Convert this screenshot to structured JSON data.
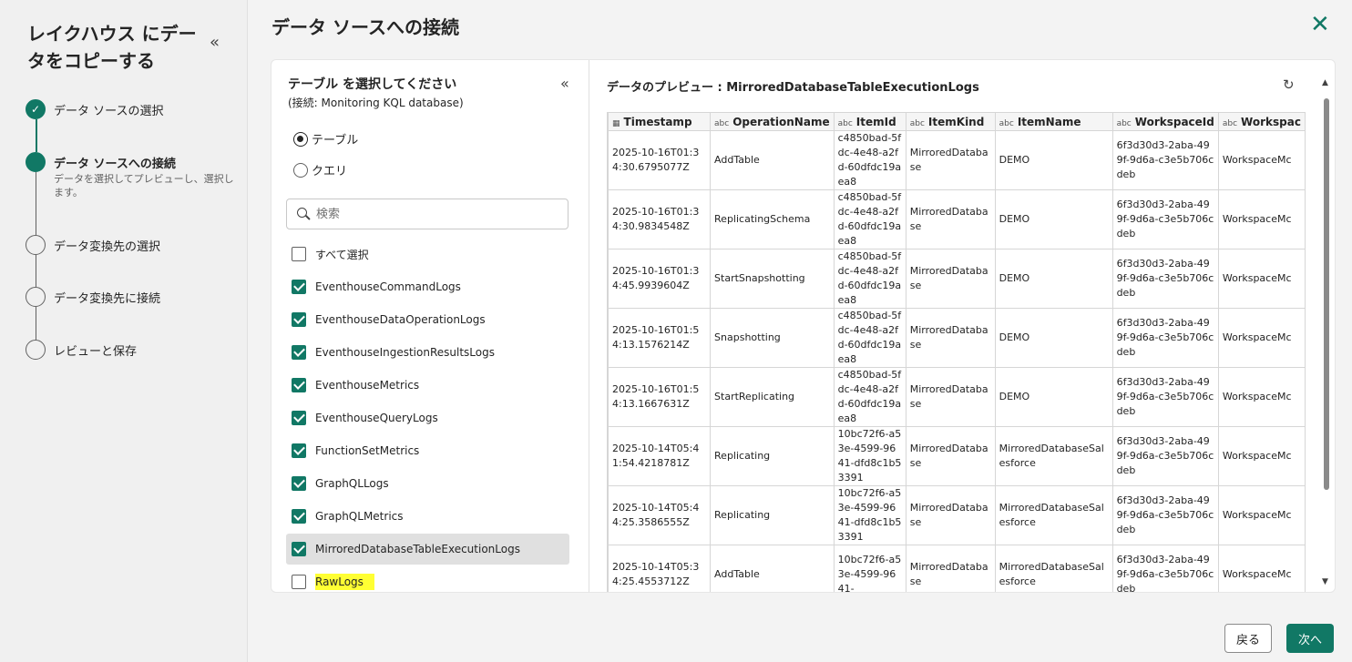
{
  "wizard": {
    "title": "レイクハウス にデータをコピーする",
    "steps": [
      {
        "label": "データ ソースの選択",
        "state": "done"
      },
      {
        "label": "データ ソースへの接続",
        "state": "active",
        "desc": "データを選択してプレビューし、選択します。"
      },
      {
        "label": "データ変換先の選択",
        "state": "pending"
      },
      {
        "label": "データ変換先に接続",
        "state": "pending"
      },
      {
        "label": "レビューと保存",
        "state": "pending"
      }
    ]
  },
  "main": {
    "title": "データ ソースへの接続"
  },
  "selector": {
    "title": "テーブル を選択してください",
    "subtitle": "(接続: Monitoring KQL database)",
    "radio_table": "テーブル",
    "radio_query": "クエリ",
    "search_placeholder": "検索",
    "select_all": "すべて選択",
    "tables": [
      {
        "name": "EventhouseCommandLogs",
        "checked": true
      },
      {
        "name": "EventhouseDataOperationLogs",
        "checked": true
      },
      {
        "name": "EventhouseIngestionResultsLogs",
        "checked": true
      },
      {
        "name": "EventhouseMetrics",
        "checked": true
      },
      {
        "name": "EventhouseQueryLogs",
        "checked": true
      },
      {
        "name": "FunctionSetMetrics",
        "checked": true
      },
      {
        "name": "GraphQLLogs",
        "checked": true
      },
      {
        "name": "GraphQLMetrics",
        "checked": true
      },
      {
        "name": "MirroredDatabaseTableExecutionLogs",
        "checked": true
      },
      {
        "name": "RawLogs",
        "checked": false
      }
    ]
  },
  "preview": {
    "title": "データのプレビュー : MirroredDatabaseTableExecutionLogs",
    "columns": [
      {
        "name": "Timestamp",
        "type": "date"
      },
      {
        "name": "OperationName",
        "type": "abc"
      },
      {
        "name": "ItemId",
        "type": "abc"
      },
      {
        "name": "ItemKind",
        "type": "abc"
      },
      {
        "name": "ItemName",
        "type": "abc"
      },
      {
        "name": "WorkspaceId",
        "type": "abc"
      },
      {
        "name": "Workspac",
        "type": "abc"
      }
    ],
    "rows": [
      [
        "2025-10-16T01:34:30.6795077Z",
        "AddTable",
        "c4850bad-5fdc-4e48-a2fd-60dfdc19aea8",
        "MirroredDatabase",
        "DEMO",
        "6f3d30d3-2aba-499f-9d6a-c3e5b706cdeb",
        "WorkspaceMc"
      ],
      [
        "2025-10-16T01:34:30.9834548Z",
        "ReplicatingSchema",
        "c4850bad-5fdc-4e48-a2fd-60dfdc19aea8",
        "MirroredDatabase",
        "DEMO",
        "6f3d30d3-2aba-499f-9d6a-c3e5b706cdeb",
        "WorkspaceMc"
      ],
      [
        "2025-10-16T01:34:45.9939604Z",
        "StartSnapshotting",
        "c4850bad-5fdc-4e48-a2fd-60dfdc19aea8",
        "MirroredDatabase",
        "DEMO",
        "6f3d30d3-2aba-499f-9d6a-c3e5b706cdeb",
        "WorkspaceMc"
      ],
      [
        "2025-10-16T01:54:13.1576214Z",
        "Snapshotting",
        "c4850bad-5fdc-4e48-a2fd-60dfdc19aea8",
        "MirroredDatabase",
        "DEMO",
        "6f3d30d3-2aba-499f-9d6a-c3e5b706cdeb",
        "WorkspaceMc"
      ],
      [
        "2025-10-16T01:54:13.1667631Z",
        "StartReplicating",
        "c4850bad-5fdc-4e48-a2fd-60dfdc19aea8",
        "MirroredDatabase",
        "DEMO",
        "6f3d30d3-2aba-499f-9d6a-c3e5b706cdeb",
        "WorkspaceMc"
      ],
      [
        "2025-10-14T05:41:54.4218781Z",
        "Replicating",
        "10bc72f6-a53e-4599-9641-dfd8c1b53391",
        "MirroredDatabase",
        "MirroredDatabaseSalesforce",
        "6f3d30d3-2aba-499f-9d6a-c3e5b706cdeb",
        "WorkspaceMc"
      ],
      [
        "2025-10-14T05:44:25.3586555Z",
        "Replicating",
        "10bc72f6-a53e-4599-9641-dfd8c1b53391",
        "MirroredDatabase",
        "MirroredDatabaseSalesforce",
        "6f3d30d3-2aba-499f-9d6a-c3e5b706cdeb",
        "WorkspaceMc"
      ],
      [
        "2025-10-14T05:34:25.4553712Z",
        "AddTable",
        "10bc72f6-a53e-4599-9641-",
        "MirroredDatabase",
        "MirroredDatabaseSalesforce",
        "6f3d30d3-2aba-499f-9d6a-c3e5b706cdeb",
        "WorkspaceMc"
      ]
    ]
  },
  "footer": {
    "back": "戻る",
    "next": "次へ"
  },
  "colors": {
    "accent": "#117865",
    "highlight": "#ffff33"
  }
}
